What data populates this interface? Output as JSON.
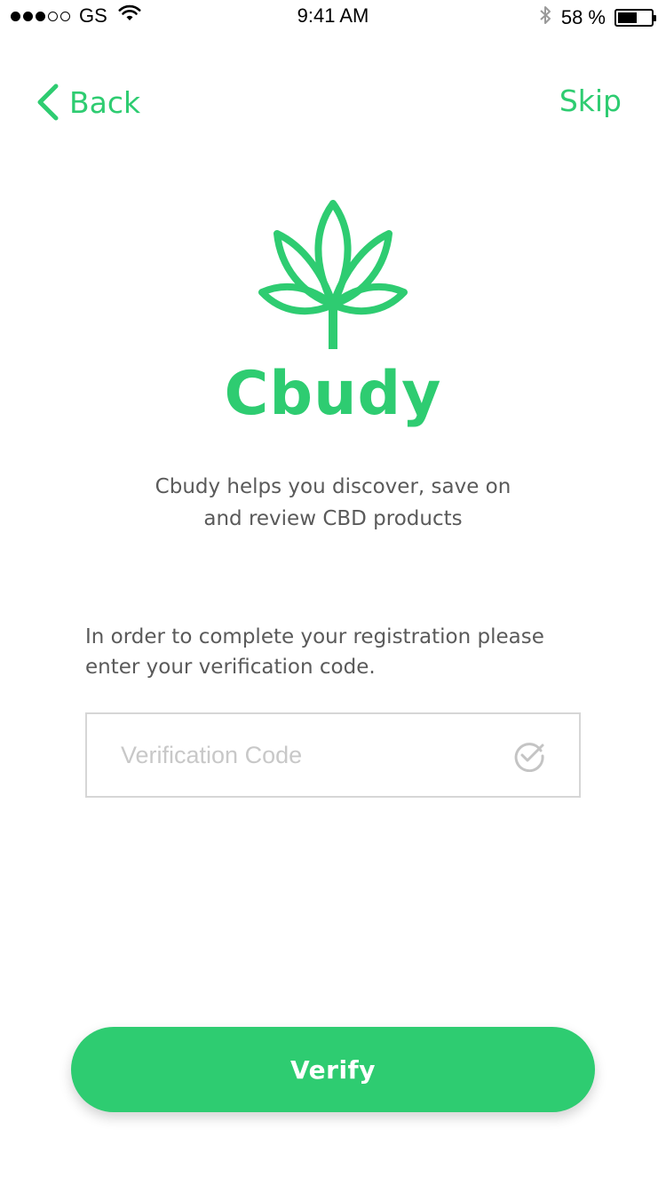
{
  "status_bar": {
    "signal_filled": 3,
    "signal_empty": 2,
    "carrier": "GS",
    "time": "9:41 AM",
    "battery_percent_label": "58 %",
    "battery_level": 0.58
  },
  "nav": {
    "back_label": "Back",
    "skip_label": "Skip"
  },
  "brand": {
    "name": "Cbudy",
    "tagline_line1": "Cbudy helps you discover, save on",
    "tagline_line2": "and review CBD products"
  },
  "verification": {
    "instructions": "In order to complete your registration please enter your verification code.",
    "code_field": {
      "value": "",
      "placeholder": "Verification Code"
    },
    "button_label": "Verify"
  },
  "colors": {
    "accent": "#2ecc71",
    "text_secondary": "#5a5a5a",
    "field_border": "#d6d6d6",
    "placeholder": "#c8c8c8"
  },
  "icons": {
    "back": "chevron-left-icon",
    "logo": "cannabis-leaf-icon",
    "field_check": "check-circle-icon",
    "wifi": "wifi-icon",
    "bluetooth": "bluetooth-icon",
    "battery": "battery-icon"
  }
}
